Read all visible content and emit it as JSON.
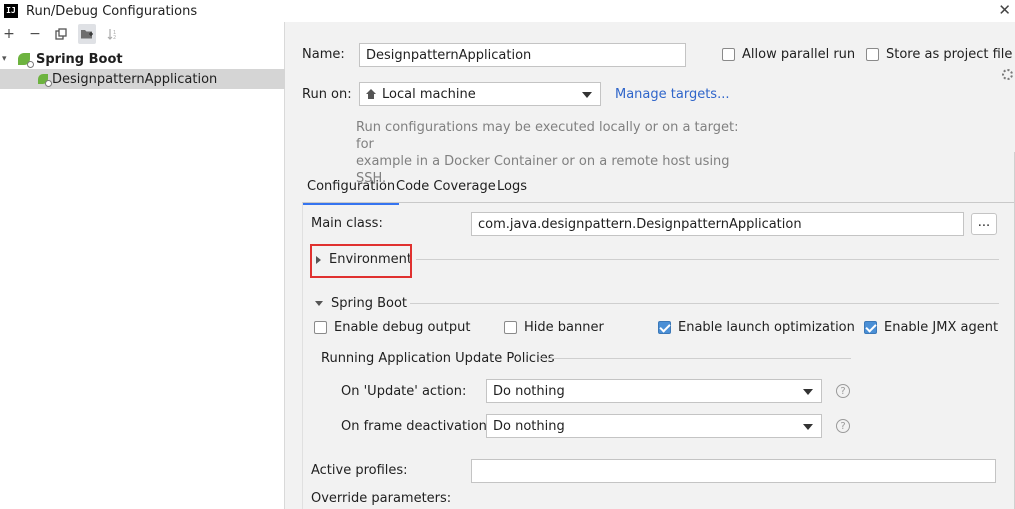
{
  "window": {
    "title": "Run/Debug Configurations",
    "app_icon": "IJ"
  },
  "toolbar": {
    "add": "+",
    "remove": "−",
    "copy": "copy-icon",
    "folder": "folder-icon",
    "sort": "sort-icon"
  },
  "tree": {
    "group": "Spring Boot",
    "item": "DesignpatternApplication"
  },
  "form": {
    "name_label": "Name:",
    "name_value": "DesignpatternApplication",
    "allow_parallel": "Allow parallel run",
    "store_as_file": "Store as project file",
    "run_on_label": "Run on:",
    "run_on_value": "Local machine",
    "manage_targets": "Manage targets...",
    "hint_line1": "Run configurations may be executed locally or on a target: for",
    "hint_line2": "example in a Docker Container or on a remote host using SSH."
  },
  "tabs": [
    "Configuration",
    "Code Coverage",
    "Logs"
  ],
  "config": {
    "main_class_label": "Main class:",
    "main_class_value": "com.java.designpattern.DesignpatternApplication",
    "browse": "...",
    "environment": "Environment",
    "spring_boot_section": "Spring Boot",
    "enable_debug": "Enable debug output",
    "hide_banner": "Hide banner",
    "launch_opt": "Enable launch optimization",
    "jmx": "Enable JMX agent",
    "policies_title": "Running Application Update Policies",
    "on_update_label": "On 'Update' action:",
    "on_update_value": "Do nothing",
    "on_frame_label": "On frame deactivation:",
    "on_frame_value": "Do nothing",
    "help": "?",
    "active_profiles": "Active profiles:",
    "override_params": "Override parameters:"
  },
  "checkbox_state": {
    "allow_parallel": false,
    "store_as_file": false,
    "enable_debug": false,
    "hide_banner": false,
    "launch_opt": true,
    "jmx": true
  },
  "colors": {
    "accent": "#3574f0",
    "check": "#4a8fd6",
    "highlight": "#e0312f",
    "link": "#2f65ca"
  }
}
